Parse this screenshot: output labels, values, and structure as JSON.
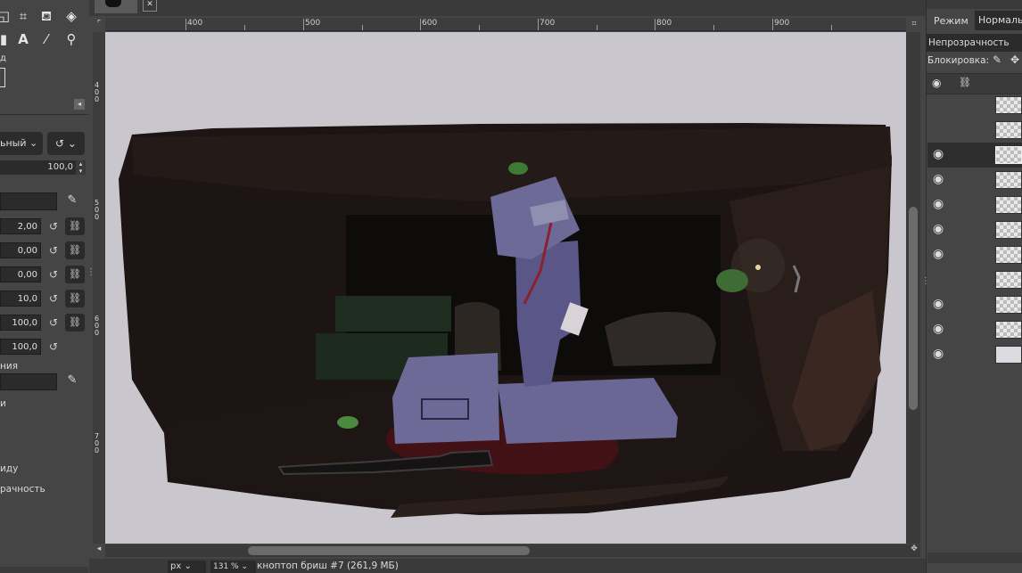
{
  "left_panel": {
    "mode_select": "ьный",
    "opacity_value": "100,0",
    "params": [
      {
        "value": "2,00"
      },
      {
        "value": "0,00"
      },
      {
        "value": "0,00"
      },
      {
        "value": "10,0"
      },
      {
        "value": "100,0"
      },
      {
        "value": "100,0"
      }
    ],
    "label_1": "ния",
    "label_2": "и",
    "label_3": "иду",
    "label_4": "рачность",
    "tool_icons": [
      "move-icon",
      "crop-icon",
      "paint-bucket-icon",
      "fill-icon",
      "text-icon",
      "color-picker-icon",
      "zoom-icon"
    ]
  },
  "tabs": {
    "close_symbol": "✕"
  },
  "ruler_top": {
    "labels": [
      "400",
      "500",
      "600",
      "700",
      "800",
      "900"
    ]
  },
  "ruler_left": {
    "labels": [
      "4\n0\n0",
      "5\n0\n0",
      "6\n0\n0",
      "7\n0\n0"
    ]
  },
  "status_bar": {
    "unit": "px",
    "zoom": "131 %",
    "title": "кноптоп бриш #7 (261,9 МБ)"
  },
  "right_panel": {
    "mode_label": "Режим",
    "mode_value": "Нормаль",
    "opacity_label": "Непрозрачность",
    "lock_label": "Блокировка:",
    "layers": [
      {
        "visible": false
      },
      {
        "visible": false
      },
      {
        "visible": true,
        "selected": true
      },
      {
        "visible": true
      },
      {
        "visible": true
      },
      {
        "visible": true
      },
      {
        "visible": true
      },
      {
        "visible": false
      },
      {
        "visible": true
      },
      {
        "visible": true
      },
      {
        "visible": true
      }
    ]
  },
  "colors": {
    "ui_bg": "#454545",
    "canvas_bg": "#c9c6ce",
    "painting_dark": "#1c1513",
    "figure_purple": "#6e6a97",
    "blood": "#4a1016",
    "helmet_green": "#3f7a35"
  }
}
